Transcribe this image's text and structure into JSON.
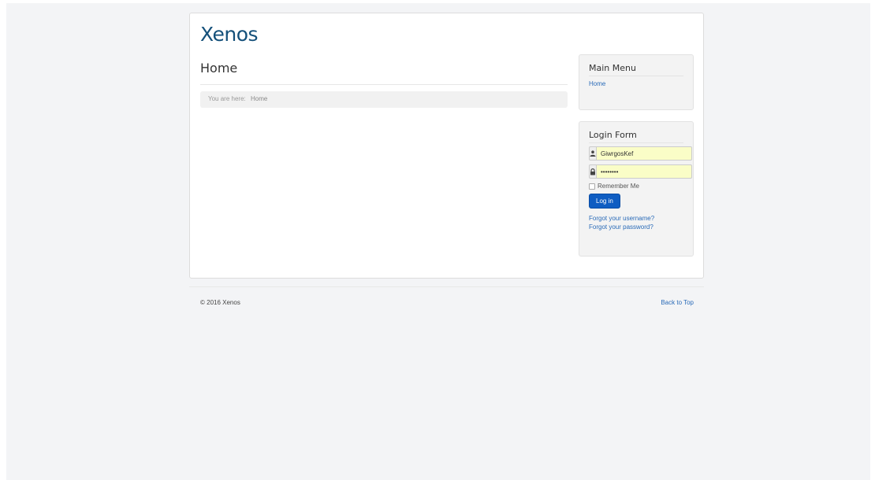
{
  "site": {
    "brand": "Xenos"
  },
  "page": {
    "title": "Home"
  },
  "breadcrumb": {
    "label": "You are here:",
    "current": "Home"
  },
  "menu_module": {
    "title": "Main Menu",
    "items": [
      {
        "label": "Home"
      }
    ]
  },
  "login_module": {
    "title": "Login Form",
    "username": {
      "value": "GiwrgosKef",
      "icon": "user-icon"
    },
    "password": {
      "value": "••••••••",
      "icon": "lock-icon"
    },
    "remember_label": "Remember Me",
    "remember_checked": false,
    "submit_label": "Log in",
    "forgot_username": "Forgot your username?",
    "forgot_password": "Forgot your password?"
  },
  "footer": {
    "copyright": "© 2016 Xenos",
    "back_to_top": "Back to Top"
  },
  "colors": {
    "brand": "#14507a",
    "link": "#2a6bb8",
    "button": "#0f5dc2",
    "autofill": "#fafdc7",
    "page_background": "#f3f4f6"
  }
}
